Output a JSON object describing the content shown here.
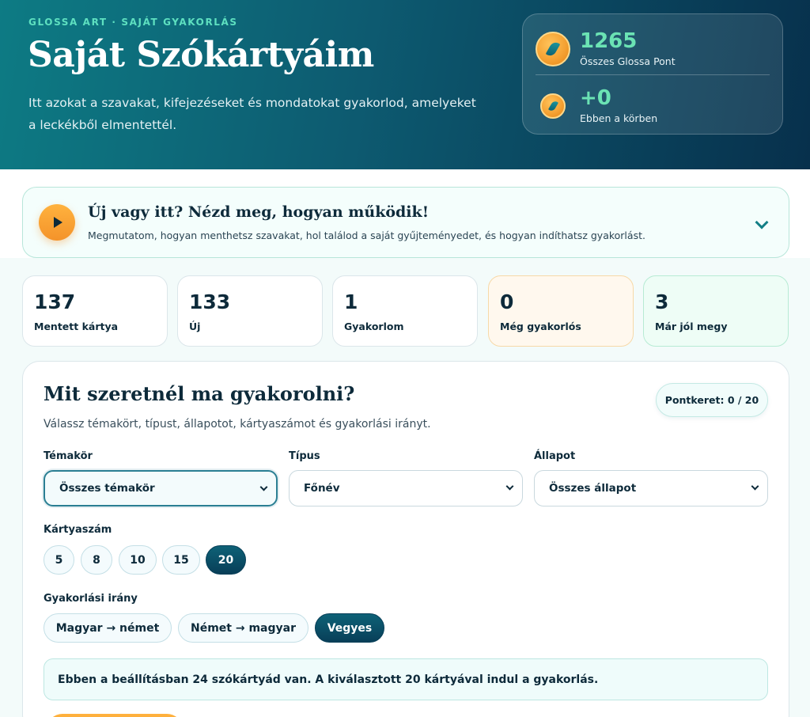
{
  "header": {
    "eyebrow": "GLOSSA ART · SAJÁT GYAKORLÁS",
    "title": "Saját Szókártyáim",
    "description": "Itt azokat a szavakat, kifejezéseket és mondatokat gyakorlod, amelyeket a leckékből elmentettél."
  },
  "points": {
    "total_value": "1265",
    "total_label": "Összes Glossa Pont",
    "round_value": "+0",
    "round_label": "Ebben a körben",
    "coin_icon": "glossa-coin-icon"
  },
  "intro": {
    "title": "Új vagy itt? Nézd meg, hogyan működik!",
    "subtitle": "Megmutatom, hogyan menthetsz szavakat, hol találod a saját gyűjteményedet, és hogyan indíthatsz gyakorlást."
  },
  "stats": [
    {
      "value": "137",
      "label": "Mentett kártya"
    },
    {
      "value": "133",
      "label": "Új"
    },
    {
      "value": "1",
      "label": "Gyakorlom"
    },
    {
      "value": "0",
      "label": "Még gyakorlós"
    },
    {
      "value": "3",
      "label": "Már jól megy"
    }
  ],
  "practice": {
    "title": "Mit szeretnél ma gyakorolni?",
    "subtitle": "Válassz témakört, típust, állapotot, kártyaszámot és gyakorlási irányt.",
    "budget": "Pontkeret: 0 / 20",
    "topic_label": "Témakör",
    "topic_value": "Összes témakör",
    "type_label": "Típus",
    "type_value": "Főnév",
    "status_label": "Állapot",
    "status_value": "Összes állapot",
    "count_label": "Kártyaszám",
    "counts": [
      "5",
      "8",
      "10",
      "15",
      "20"
    ],
    "count_selected": "20",
    "direction_label": "Gyakorlási irány",
    "directions": [
      "Magyar → német",
      "Német → magyar",
      "Vegyes"
    ],
    "direction_selected": "Vegyes",
    "info": "Ebben a beállításban 24 szókártyád van. A kiválasztott 20 kártyával indul a gyakorlás."
  },
  "colors": {
    "accent": "#0d5a70",
    "highlight_green": "#6be3b4",
    "orange": "#f5a233"
  }
}
